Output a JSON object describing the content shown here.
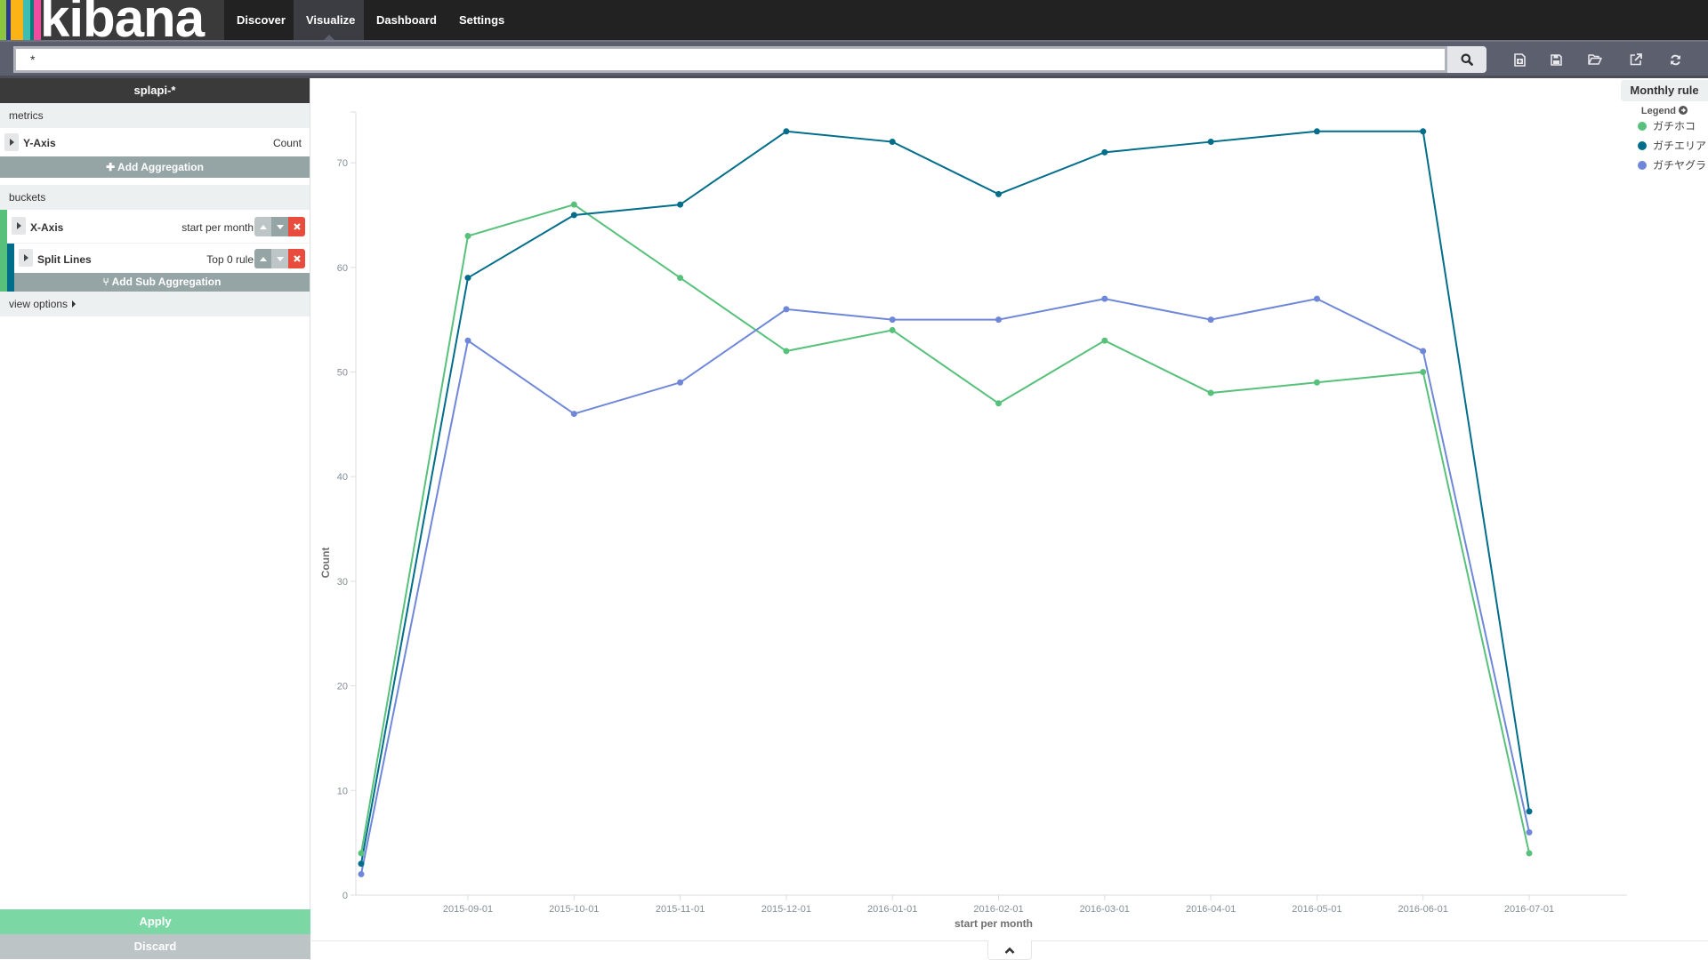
{
  "app": {
    "logo_text": "kibana",
    "logo_stripes": [
      "#8cc63f",
      "#2b3991",
      "#fcb316",
      "#3ebeb0",
      "#0b7a79",
      "#ef4b9f"
    ]
  },
  "nav": {
    "tabs": [
      {
        "label": "Discover",
        "active": false
      },
      {
        "label": "Visualize",
        "active": true
      },
      {
        "label": "Dashboard",
        "active": false
      },
      {
        "label": "Settings",
        "active": false
      }
    ]
  },
  "search": {
    "query": "*",
    "search_icon": "search-icon",
    "toolbar_icons": [
      "new-visualization-icon",
      "save-icon",
      "open-icon",
      "share-icon",
      "refresh-icon"
    ]
  },
  "sidebar": {
    "index_pattern": "splapi-*",
    "metrics_label": "metrics",
    "metrics": [
      {
        "title": "Y-Axis",
        "description": "Count"
      }
    ],
    "add_aggregation_label": "Add Aggregation",
    "buckets_label": "buckets",
    "buckets": [
      {
        "title": "X-Axis",
        "description": "start per month"
      },
      {
        "title": "Split Lines",
        "description": "Top 0 rule"
      }
    ],
    "add_sub_aggregation_label": "Add Sub Aggregation",
    "view_options_label": "view options",
    "apply_label": "Apply",
    "discard_label": "Discard"
  },
  "legend": {
    "title": "Monthly rule",
    "toggle_label": "Legend"
  },
  "chart_data": {
    "type": "line",
    "title": "Monthly rule",
    "xlabel": "start per month",
    "ylabel": "Count",
    "ylim": [
      0,
      75
    ],
    "yticks": [
      0,
      10,
      20,
      30,
      40,
      50,
      60,
      70
    ],
    "x": [
      "2015-08-31",
      "2015-09-01",
      "2015-10-01",
      "2015-11-01",
      "2015-12-01",
      "2016-01-01",
      "2016-02-01",
      "2016-03-01",
      "2016-04-01",
      "2016-05-01",
      "2016-06-01",
      "2016-07-01"
    ],
    "x_tick_labels": [
      "",
      "2015-09-01",
      "2015-10-01",
      "2015-11-01",
      "2015-12-01",
      "2016-01-01",
      "2016-02-01",
      "2016-03-01",
      "2016-04-01",
      "2016-05-01",
      "2016-06-01",
      "2016-07-01"
    ],
    "grid": false,
    "legend_position": "top-right",
    "series": [
      {
        "name": "ガチホコ",
        "color": "#57c17b",
        "values": [
          4,
          63,
          66,
          59,
          52,
          54,
          47,
          53,
          48,
          49,
          50,
          4
        ]
      },
      {
        "name": "ガチエリア",
        "color": "#006e8a",
        "values": [
          3,
          59,
          65,
          66,
          73,
          72,
          67,
          71,
          72,
          73,
          73,
          8
        ]
      },
      {
        "name": "ガチヤグラ",
        "color": "#6f87d8",
        "values": [
          2,
          53,
          46,
          49,
          56,
          55,
          55,
          57,
          55,
          57,
          52,
          6
        ]
      }
    ]
  }
}
